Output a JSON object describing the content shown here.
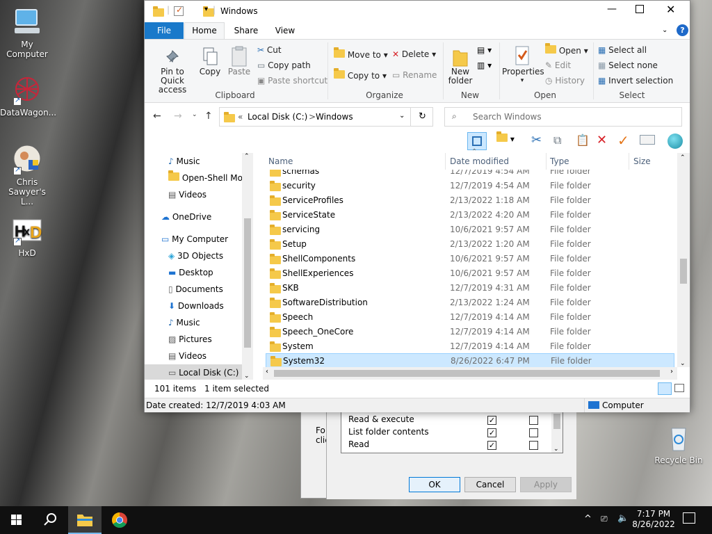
{
  "desktop": {
    "icons": [
      {
        "label": "My Computer"
      },
      {
        "label": "DataWagon..."
      },
      {
        "label": "Chris Sawyer's L..."
      },
      {
        "label": "HxD"
      },
      {
        "label": "Recycle Bin"
      }
    ]
  },
  "dialog": {
    "left_text": "Fo",
    "left_text2": "clic",
    "permissions": [
      {
        "label": "Read & execute",
        "allow": "✓",
        "deny": ""
      },
      {
        "label": "List folder contents",
        "allow": "✓",
        "deny": ""
      },
      {
        "label": "Read",
        "allow": "✓",
        "deny": ""
      }
    ],
    "ok": "OK",
    "cancel": "Cancel",
    "apply": "Apply"
  },
  "window": {
    "title": "Windows",
    "tabs": [
      "File",
      "Home",
      "Share",
      "View"
    ],
    "help": "?",
    "ribbon": {
      "clipboard": {
        "pin": "Pin to Quick access",
        "copy": "Copy",
        "paste": "Paste",
        "cut": "Cut",
        "copy_path": "Copy path",
        "paste_shortcut": "Paste shortcut",
        "label": "Clipboard"
      },
      "organize": {
        "move_to": "Move to",
        "copy_to": "Copy to",
        "delete": "Delete",
        "rename": "Rename",
        "label": "Organize"
      },
      "new": {
        "new_folder": "New folder",
        "label": "New"
      },
      "open": {
        "properties": "Properties",
        "open": "Open",
        "edit": "Edit",
        "history": "History",
        "label": "Open"
      },
      "select": {
        "select_all": "Select all",
        "select_none": "Select none",
        "invert": "Invert selection",
        "label": "Select"
      }
    },
    "address": {
      "chevrons": "«",
      "crumb1": "Local Disk (C:)",
      "sep": ">",
      "crumb2": "Windows"
    },
    "search_placeholder": "Search Windows",
    "nav": [
      {
        "label": "Music",
        "icon": "music-icon",
        "indent": 1
      },
      {
        "label": "Open-Shell Mod",
        "icon": "folder-icon",
        "indent": 1
      },
      {
        "label": "Videos",
        "icon": "video-icon",
        "indent": 1
      },
      {
        "label": "OneDrive",
        "icon": "cloud-icon",
        "indent": 0
      },
      {
        "label": "My Computer",
        "icon": "computer-icon",
        "indent": 0
      },
      {
        "label": "3D Objects",
        "icon": "cube-icon",
        "indent": 1
      },
      {
        "label": "Desktop",
        "icon": "desktop-icon",
        "indent": 1
      },
      {
        "label": "Documents",
        "icon": "document-icon",
        "indent": 1
      },
      {
        "label": "Downloads",
        "icon": "download-icon",
        "indent": 1
      },
      {
        "label": "Music",
        "icon": "music-icon",
        "indent": 1
      },
      {
        "label": "Pictures",
        "icon": "picture-icon",
        "indent": 1
      },
      {
        "label": "Videos",
        "icon": "video-icon",
        "indent": 1
      },
      {
        "label": "Local Disk (C:)",
        "icon": "drive-icon",
        "indent": 1
      }
    ],
    "columns": {
      "name": "Name",
      "date": "Date modified",
      "type": "Type",
      "size": "Size"
    },
    "files": [
      {
        "name": "schemas",
        "date": "12/7/2019 4:54 AM",
        "type": "File folder"
      },
      {
        "name": "security",
        "date": "12/7/2019 4:54 AM",
        "type": "File folder"
      },
      {
        "name": "ServiceProfiles",
        "date": "2/13/2022 1:18 AM",
        "type": "File folder"
      },
      {
        "name": "ServiceState",
        "date": "2/13/2022 4:20 AM",
        "type": "File folder"
      },
      {
        "name": "servicing",
        "date": "10/6/2021 9:57 AM",
        "type": "File folder"
      },
      {
        "name": "Setup",
        "date": "2/13/2022 1:20 AM",
        "type": "File folder"
      },
      {
        "name": "ShellComponents",
        "date": "10/6/2021 9:57 AM",
        "type": "File folder"
      },
      {
        "name": "ShellExperiences",
        "date": "10/6/2021 9:57 AM",
        "type": "File folder"
      },
      {
        "name": "SKB",
        "date": "12/7/2019 4:31 AM",
        "type": "File folder"
      },
      {
        "name": "SoftwareDistribution",
        "date": "2/13/2022 1:24 AM",
        "type": "File folder"
      },
      {
        "name": "Speech",
        "date": "12/7/2019 4:14 AM",
        "type": "File folder"
      },
      {
        "name": "Speech_OneCore",
        "date": "12/7/2019 4:14 AM",
        "type": "File folder"
      },
      {
        "name": "System",
        "date": "12/7/2019 4:14 AM",
        "type": "File folder"
      },
      {
        "name": "System32",
        "date": "8/26/2022 6:47 PM",
        "type": "File folder",
        "selected": true
      }
    ],
    "status": {
      "count": "101 items",
      "selected": "1 item selected"
    },
    "details": {
      "created": "Date created: 12/7/2019 4:03 AM",
      "location": "Computer"
    }
  },
  "taskbar": {
    "time": "7:17 PM",
    "date": "8/26/2022"
  }
}
